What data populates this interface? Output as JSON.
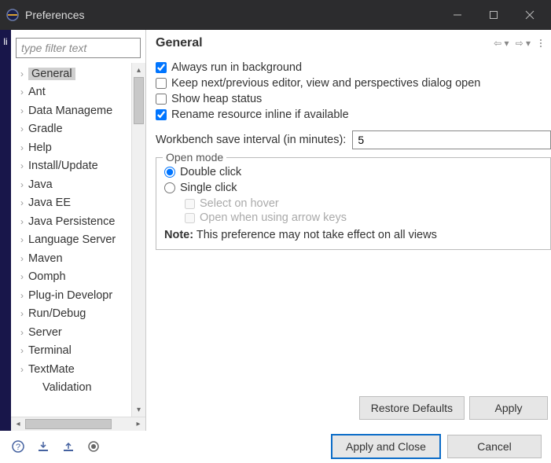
{
  "window": {
    "title": "Preferences"
  },
  "sidebar": {
    "filter_placeholder": "type filter text",
    "items": [
      {
        "label": "General",
        "selected": true
      },
      {
        "label": "Ant"
      },
      {
        "label": "Data Manageme"
      },
      {
        "label": "Gradle"
      },
      {
        "label": "Help"
      },
      {
        "label": "Install/Update"
      },
      {
        "label": "Java"
      },
      {
        "label": "Java EE"
      },
      {
        "label": "Java Persistence"
      },
      {
        "label": "Language Server"
      },
      {
        "label": "Maven"
      },
      {
        "label": "Oomph"
      },
      {
        "label": "Plug-in Developr"
      },
      {
        "label": "Run/Debug"
      },
      {
        "label": "Server"
      },
      {
        "label": "Terminal"
      },
      {
        "label": "TextMate"
      },
      {
        "label": "Validation",
        "sub": true
      }
    ]
  },
  "page": {
    "title": "General",
    "options": {
      "always_bg": {
        "label": "Always run in background",
        "checked": true
      },
      "keep_next": {
        "label": "Keep next/previous editor, view and perspectives dialog open",
        "checked": false
      },
      "heap": {
        "label": "Show heap status",
        "checked": false
      },
      "rename": {
        "label": "Rename resource inline if available",
        "checked": true
      }
    },
    "interval": {
      "label": "Workbench save interval (in minutes):",
      "value": "5"
    },
    "open_mode": {
      "legend": "Open mode",
      "double": "Double click",
      "single": "Single click",
      "selected": "double",
      "select_hover": "Select on hover",
      "open_arrow": "Open when using arrow keys"
    },
    "note_label": "Note:",
    "note_text": "This preference may not take effect on all views",
    "restore_defaults": "Restore Defaults",
    "apply": "Apply"
  },
  "footer": {
    "apply_close": "Apply and Close",
    "cancel": "Cancel"
  }
}
